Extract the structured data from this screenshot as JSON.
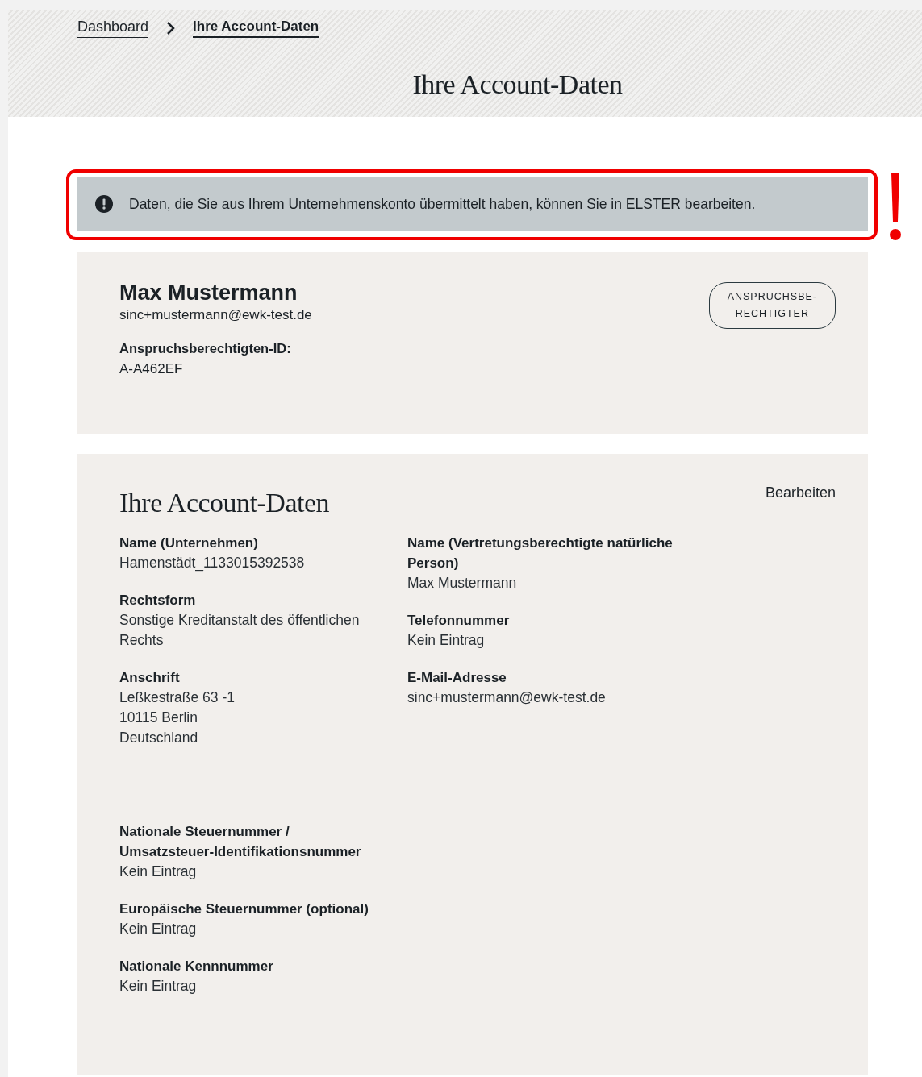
{
  "breadcrumb": [
    {
      "label": "Dashboard",
      "current": false
    },
    {
      "label": "Ihre Account-Daten",
      "current": true
    }
  ],
  "page_title": "Ihre Account-Daten",
  "notice": {
    "text": "Daten, die Sie aus Ihrem Unternehmenskonto übermittelt haben, können Sie in ELSTER bearbeiten.",
    "highlighted": true
  },
  "profile": {
    "name": "Max Mustermann",
    "email": "sinc+mustermann@ewk-test.de",
    "id_label": "Anspruchsberechtigten-ID:",
    "id_value": "A-A462EF",
    "role_badge": "ANSPRUCHSBE-\nRECHTIGTER"
  },
  "account": {
    "title": "Ihre Account-Daten",
    "edit_link": "Bearbeiten",
    "left_fields": [
      {
        "label": "Name (Unternehmen)",
        "lines": [
          "Hamenstädt_1133015392538"
        ]
      },
      {
        "label": "Rechtsform",
        "lines": [
          "Sonstige Kreditanstalt des öffentlichen Rechts"
        ]
      },
      {
        "label": "Anschrift",
        "lines": [
          "Leßkestraße 63 -1",
          "10115 Berlin",
          "Deutschland"
        ]
      }
    ],
    "right_fields": [
      {
        "label": "Name (Vertretungsberechtigte natürliche Person)",
        "lines": [
          "Max Mustermann"
        ]
      },
      {
        "label": "Telefonnummer",
        "lines": [
          "Kein Eintrag"
        ]
      },
      {
        "label": "E-Mail-Adresse",
        "lines": [
          "sinc+mustermann@ewk-test.de"
        ]
      }
    ],
    "tax_fields": [
      {
        "label": "Nationale Steuernummer / Umsatzsteuer-Identifikationsnummer",
        "lines": [
          "Kein Eintrag"
        ]
      },
      {
        "label": "Europäische Steuernummer (optional)",
        "lines": [
          "Kein Eintrag"
        ]
      },
      {
        "label": "Nationale Kennnummer",
        "lines": [
          "Kein Eintrag"
        ]
      }
    ]
  }
}
